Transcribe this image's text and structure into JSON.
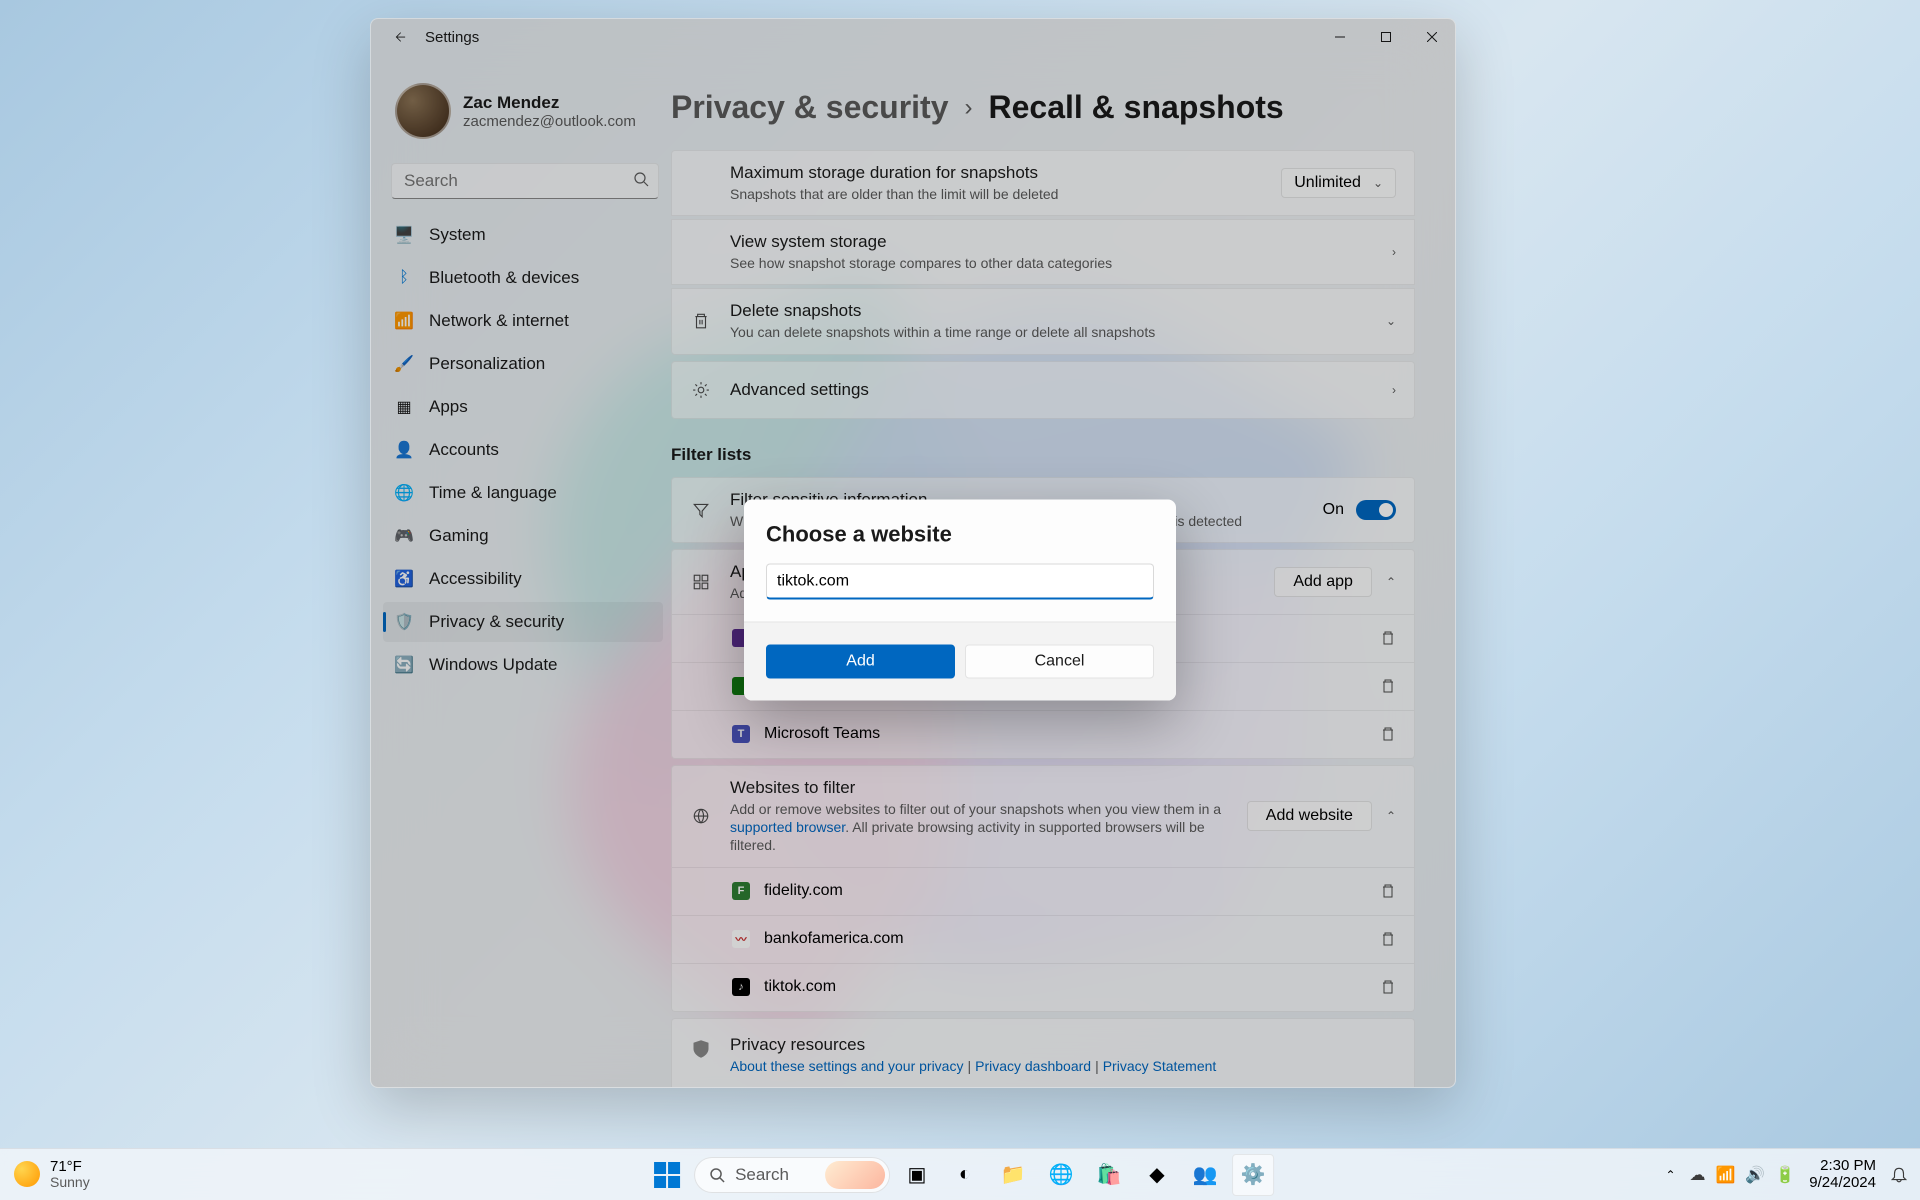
{
  "window": {
    "title": "Settings",
    "profile": {
      "name": "Zac Mendez",
      "email": "zacmendez@outlook.com"
    },
    "search_placeholder": "Search",
    "nav": [
      {
        "label": "System"
      },
      {
        "label": "Bluetooth & devices"
      },
      {
        "label": "Network & internet"
      },
      {
        "label": "Personalization"
      },
      {
        "label": "Apps"
      },
      {
        "label": "Accounts"
      },
      {
        "label": "Time & language"
      },
      {
        "label": "Gaming"
      },
      {
        "label": "Accessibility"
      },
      {
        "label": "Privacy & security"
      },
      {
        "label": "Windows Update"
      }
    ],
    "breadcrumb": {
      "parent": "Privacy & security",
      "current": "Recall & snapshots"
    },
    "cards": {
      "max_storage": {
        "title": "Maximum storage duration for snapshots",
        "sub": "Snapshots that are older than the limit will be deleted",
        "value": "Unlimited"
      },
      "view_storage": {
        "title": "View system storage",
        "sub": "See how snapshot storage compares to other data categories"
      },
      "delete_snaps": {
        "title": "Delete snapshots",
        "sub": "You can delete snapshots within a time range or delete all snapshots"
      },
      "advanced": {
        "title": "Advanced settings"
      },
      "filter_header": "Filter lists",
      "filter_sensitive": {
        "title": "Filter sensitive information",
        "sub": "Windows will not save snapshots when potentially sensitive information is detected",
        "toggle_label": "On"
      },
      "apps_filter": {
        "title": "Apps to filter",
        "sub": "Add or remove apps to filter out of your snapshots",
        "btn": "Add app"
      },
      "apps": [
        {
          "name": ""
        },
        {
          "name": ""
        },
        {
          "name": "Microsoft Teams"
        }
      ],
      "sites_filter": {
        "title": "Websites to filter",
        "sub1": "Add or remove websites to filter out of your snapshots when you view them in a ",
        "link": "supported browser",
        "sub2": ". All private browsing activity in supported browsers will be filtered.",
        "btn": "Add website"
      },
      "sites": [
        {
          "name": "fidelity.com",
          "color": "#2e7d32"
        },
        {
          "name": "bankofamerica.com",
          "color": "#c62828"
        },
        {
          "name": "tiktok.com",
          "color": "#000000"
        }
      ],
      "privacy_res": {
        "title": "Privacy resources",
        "l1": "About these settings and your privacy",
        "l2": "Privacy dashboard",
        "l3": "Privacy Statement"
      }
    }
  },
  "modal": {
    "title": "Choose a website",
    "value": "tiktok.com",
    "add": "Add",
    "cancel": "Cancel"
  },
  "taskbar": {
    "weather": {
      "temp": "71°F",
      "cond": "Sunny"
    },
    "search": "Search",
    "time": "2:30 PM",
    "date": "9/24/2024"
  },
  "colors": {
    "accent": "#0067c0"
  }
}
